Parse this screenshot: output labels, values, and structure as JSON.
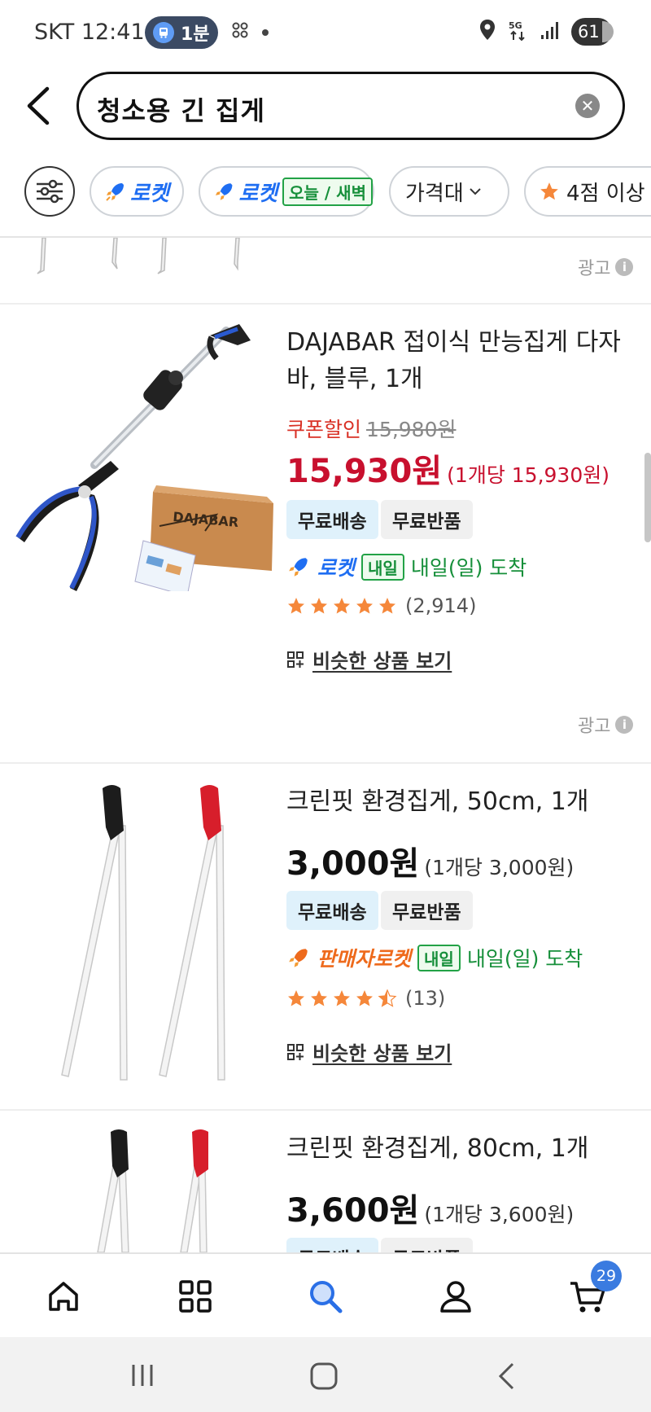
{
  "status_bar": {
    "carrier_time": "SKT 12:41",
    "transit_label": "1분",
    "battery": "61"
  },
  "search": {
    "query": "청소용 긴 집게"
  },
  "chips": {
    "rocket": "로켓",
    "rocket_today": "로켓",
    "rocket_today_tag": "오늘 / 새벽",
    "price_range": "가격대",
    "rating": "4점 이상"
  },
  "ad_label": "광고",
  "products": [
    {
      "title": "DAJABAR 접이식 만능집게 다자바, 블루, 1개",
      "coupon_label": "쿠폰할인",
      "original_price": "15,980원",
      "price": "15,930원",
      "unit_price": "(1개당 15,930원)",
      "badges": [
        "무료배송",
        "무료반품"
      ],
      "delivery_brand": "로켓",
      "delivery_tag": "내일",
      "arrival": "내일(일) 도착",
      "rating": 5,
      "reviews": "(2,914)",
      "similar": "비슷한 상품 보기",
      "image_text": "DAJABAR"
    },
    {
      "title": "크린핏 환경집게, 50cm, 1개",
      "price": "3,000원",
      "unit_price": "(1개당 3,000원)",
      "badges": [
        "무료배송",
        "무료반품"
      ],
      "delivery_brand": "판매자로켓",
      "delivery_tag": "내일",
      "arrival": "내일(일) 도착",
      "rating": 4.5,
      "reviews": "(13)",
      "similar": "비슷한 상품 보기"
    },
    {
      "title": "크린핏 환경집게, 80cm, 1개",
      "price": "3,600원",
      "unit_price": "(1개당 3,600원)",
      "badges": [
        "무료배송",
        "무료반품"
      ]
    }
  ],
  "bottom_nav": {
    "cart_count": "29"
  },
  "colors": {
    "accent_blue": "#1f6ef2",
    "price_red": "#c8102e",
    "arrival_green": "#168f3a",
    "star_orange": "#f5873a"
  }
}
